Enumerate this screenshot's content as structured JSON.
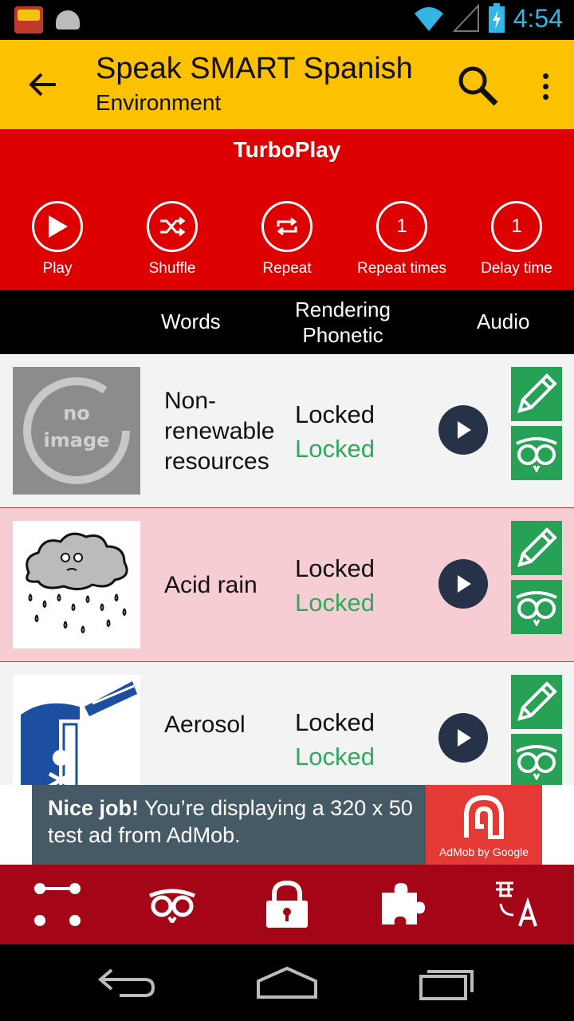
{
  "status_bar": {
    "time": "4:54",
    "icons": [
      "app-notification-icon",
      "android-icon",
      "wifi-icon",
      "signal-icon",
      "battery-charging-icon"
    ]
  },
  "toolbar": {
    "title": "Speak SMART Spanish",
    "subtitle": "Environment",
    "back_icon": "arrow-back-icon",
    "search_icon": "search-icon",
    "more_icon": "more-vert-icon",
    "background": "#fcc100"
  },
  "turboplay": {
    "heading": "TurboPlay",
    "background": "#dd0000",
    "controls": [
      {
        "label": "Play",
        "icon": "play-icon"
      },
      {
        "label": "Shuffle",
        "icon": "shuffle-icon"
      },
      {
        "label": "Repeat",
        "icon": "repeat-icon"
      },
      {
        "label": "Repeat times",
        "value": "1"
      },
      {
        "label": "Delay time",
        "value": "1"
      }
    ]
  },
  "columns": {
    "words": "Words",
    "rendering_line1": "Rendering",
    "rendering_line2": "Phonetic",
    "audio": "Audio"
  },
  "rows": [
    {
      "word": "Non-renewable resources",
      "rendering": "Locked",
      "phonetic": "Locked",
      "image": "no-image-placeholder",
      "thumb_text_1": "no",
      "thumb_text_2": "image"
    },
    {
      "word": "Acid rain",
      "rendering": "Locked",
      "phonetic": "Locked",
      "image": "acid-rain-cloud-illustration"
    },
    {
      "word": "Aerosol",
      "rendering": "Locked",
      "phonetic": "Locked",
      "image": "aerosol-can-illustration"
    }
  ],
  "ad": {
    "bold": "Nice job!",
    "text": " You’re displaying a 320 x 50 test ad from AdMob.",
    "brand": "AdMob by Google"
  },
  "bottom_nav": [
    {
      "icon": "dots-grid-icon"
    },
    {
      "icon": "owl-icon"
    },
    {
      "icon": "lock-icon"
    },
    {
      "icon": "puzzle-icon"
    },
    {
      "icon": "translate-icon"
    }
  ],
  "system_nav": [
    "back-icon",
    "home-icon",
    "recents-icon"
  ]
}
